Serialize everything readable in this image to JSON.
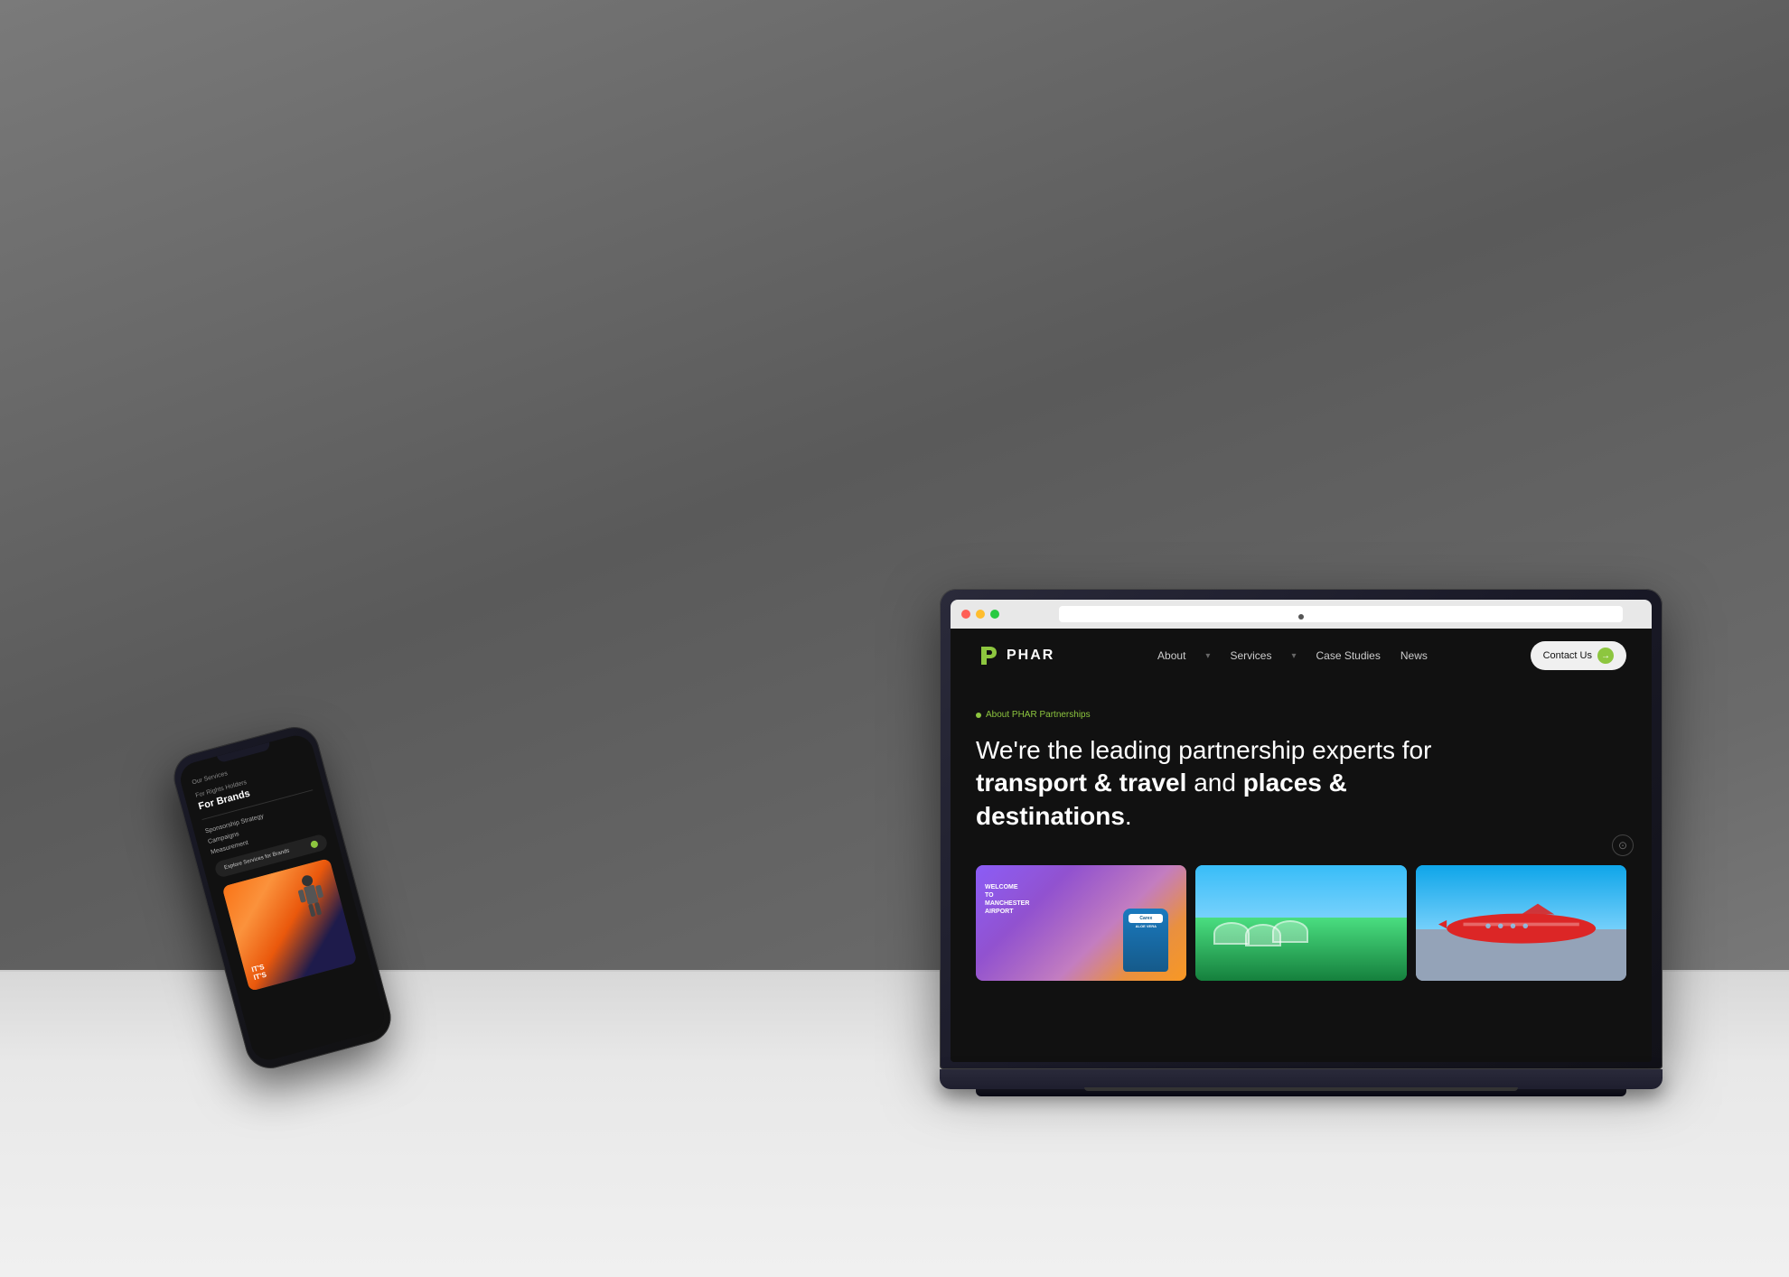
{
  "background": {
    "color": "#6a6a6a"
  },
  "laptop": {
    "browser": {
      "dots": [
        "red",
        "yellow",
        "green"
      ]
    },
    "website": {
      "logo": {
        "icon": "P",
        "text": "PHAR"
      },
      "nav": {
        "links": [
          {
            "label": "About",
            "hasDropdown": true
          },
          {
            "label": "Services",
            "hasDropdown": true
          },
          {
            "label": "Case Studies",
            "hasDropdown": false
          },
          {
            "label": "News",
            "hasDropdown": false
          }
        ],
        "cta": {
          "label": "Contact Us",
          "arrow": "→"
        }
      },
      "hero": {
        "about_label": "About PHAR Partnerships",
        "heading_normal": "We're the leading partnership experts for",
        "heading_bold_1": "transport & travel",
        "heading_connector": "and",
        "heading_bold_2": "places & destinations",
        "heading_end": "."
      },
      "images": [
        {
          "alt": "Manchester Airport Carex campaign",
          "description": "Purple interior with Carex bottle display"
        },
        {
          "alt": "Eden Project domes landscape",
          "description": "Green landscape with geodesic domes"
        },
        {
          "alt": "Red airplane on tarmac",
          "description": "Red airline aircraft on runway"
        }
      ]
    }
  },
  "phone": {
    "nav_back": "Our Services",
    "for_rights": "For Rights Holders",
    "for_brands": "For Brands",
    "menu_items": [
      "Sponsorship Strategy",
      "Campaigns",
      "Measurement"
    ],
    "cta": {
      "label": "Explore Services for Brands"
    },
    "image_alt": "Indoor action sports venue"
  }
}
